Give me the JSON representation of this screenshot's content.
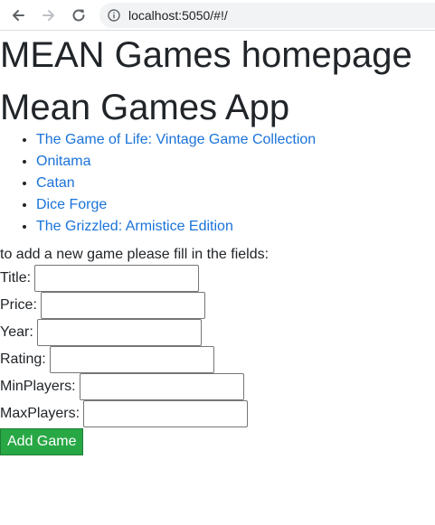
{
  "browser": {
    "url": "localhost:5050/#!/"
  },
  "page": {
    "heading": "MEAN Games homepage",
    "app_title": "Mean Games App",
    "games": [
      "The Game of Life: Vintage Game Collection",
      "Onitama",
      "Catan",
      "Dice Forge",
      "The Grizzled: Armistice Edition"
    ],
    "form_prompt": "to add a new game please fill in the fields:",
    "fields": {
      "title": "Title:",
      "price": "Price:",
      "year": "Year:",
      "rating": "Rating:",
      "min_players": "MinPlayers:",
      "max_players": "MaxPlayers:"
    },
    "add_button": "Add Game"
  },
  "colors": {
    "link": "#1a73d9",
    "button_bg": "#28a745"
  },
  "icons": {
    "back": "back-arrow-icon",
    "forward": "forward-arrow-icon",
    "reload": "reload-icon",
    "info": "info-icon"
  }
}
